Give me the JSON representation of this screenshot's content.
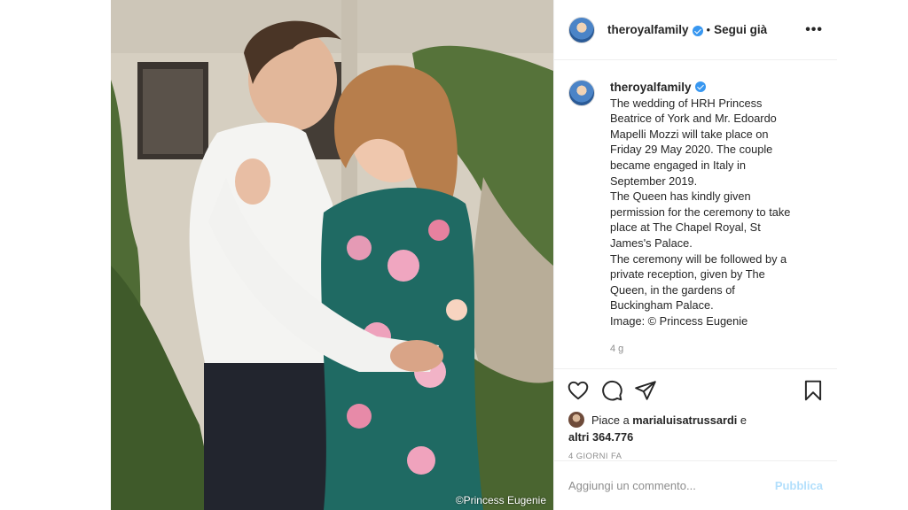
{
  "post": {
    "watermark": "©Princess Eugenie"
  },
  "header": {
    "username": "theroyalfamily",
    "separator": "•",
    "follow_label": "Segui già",
    "more_label": "•••"
  },
  "caption": {
    "username": "theroyalfamily",
    "lines": [
      "The wedding of HRH Princess",
      "Beatrice of York and Mr. Edoardo",
      "Mapelli Mozzi will take place on",
      "Friday 29 May 2020. The couple",
      "became engaged in Italy in",
      "September 2019.",
      "The Queen has kindly given",
      "permission for the ceremony to take",
      "place at The Chapel Royal, St",
      "James's Palace.",
      "The ceremony will be followed by a",
      "private reception, given by The",
      "Queen, in the gardens of",
      "Buckingham Palace.",
      "Image: © Princess Eugenie"
    ],
    "time_ago": "4 g"
  },
  "actions": {
    "like_icon": "heart-icon",
    "comment_icon": "comment-icon",
    "share_icon": "paper-plane-icon",
    "save_icon": "bookmark-icon"
  },
  "likes": {
    "prefix": "Piace a",
    "user": "marialuisatrussardi",
    "conj": "e",
    "others": "altri 364.776"
  },
  "date": "4 GIORNI FA",
  "comment": {
    "placeholder": "Aggiungi un commento...",
    "publish_label": "Pubblica"
  },
  "colors": {
    "verified": "#3897f0",
    "publish_disabled": "#b2dffc",
    "muted": "#8e8e8e"
  }
}
